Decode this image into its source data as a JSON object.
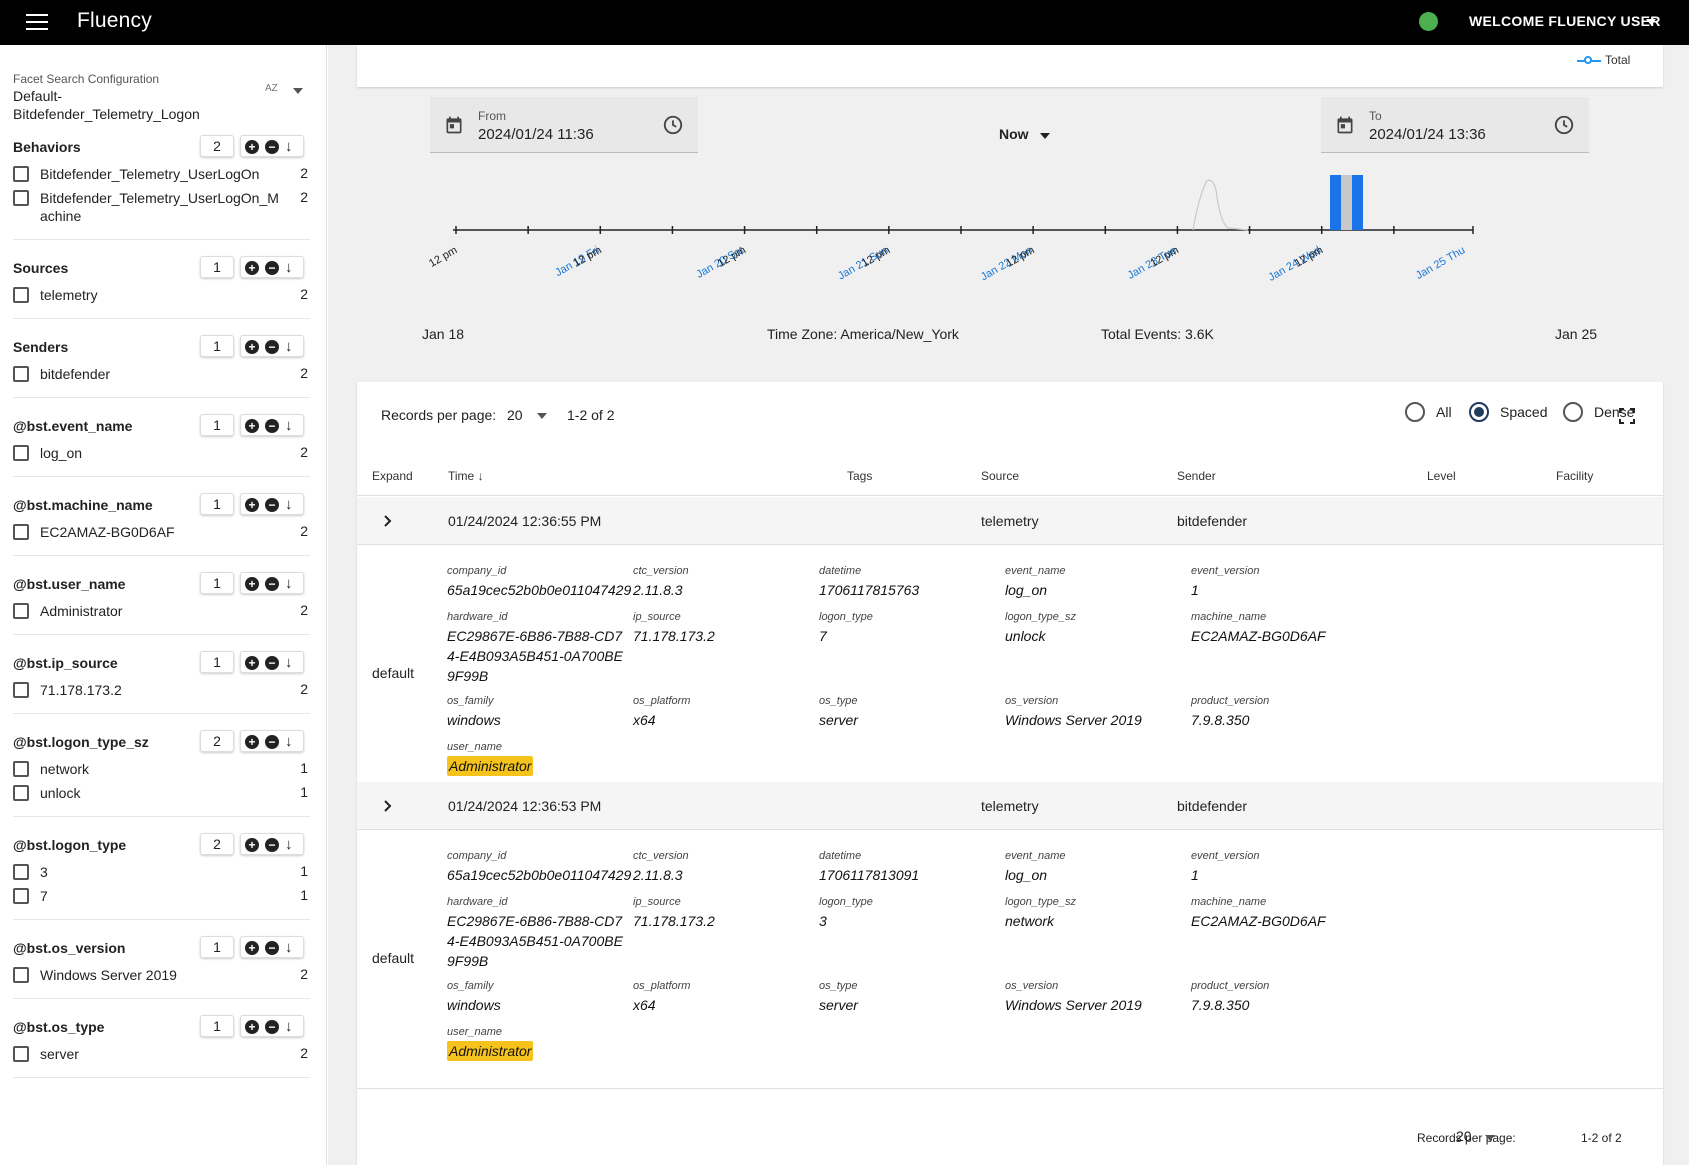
{
  "header": {
    "app_title": "Fluency",
    "welcome": "WELCOME FLUENCY USER"
  },
  "sidebar": {
    "config_label": "Facet Search Configuration",
    "config_value": "Default-Bitdefender_Telemetry_Logon",
    "sort_label": "AZ",
    "facets": [
      {
        "title": "Behaviors",
        "count": "2",
        "items": [
          {
            "label": "Bitdefender_Telemetry_UserLogOn",
            "n": "2"
          },
          {
            "label": "Bitdefender_Telemetry_UserLogOn_Machine",
            "n": "2"
          }
        ]
      },
      {
        "title": "Sources",
        "count": "1",
        "items": [
          {
            "label": "telemetry",
            "n": "2"
          }
        ]
      },
      {
        "title": "Senders",
        "count": "1",
        "items": [
          {
            "label": "bitdefender",
            "n": "2"
          }
        ]
      },
      {
        "title": "@bst.event_name",
        "count": "1",
        "items": [
          {
            "label": "log_on",
            "n": "2"
          }
        ]
      },
      {
        "title": "@bst.machine_name",
        "count": "1",
        "items": [
          {
            "label": "EC2AMAZ-BG0D6AF",
            "n": "2"
          }
        ]
      },
      {
        "title": "@bst.user_name",
        "count": "1",
        "items": [
          {
            "label": "Administrator",
            "n": "2"
          }
        ]
      },
      {
        "title": "@bst.ip_source",
        "count": "1",
        "items": [
          {
            "label": "71.178.173.2",
            "n": "2"
          }
        ]
      },
      {
        "title": "@bst.logon_type_sz",
        "count": "2",
        "items": [
          {
            "label": "network",
            "n": "1"
          },
          {
            "label": "unlock",
            "n": "1"
          }
        ]
      },
      {
        "title": "@bst.logon_type",
        "count": "2",
        "items": [
          {
            "label": "3",
            "n": "1"
          },
          {
            "label": "7",
            "n": "1"
          }
        ]
      },
      {
        "title": "@bst.os_version",
        "count": "1",
        "items": [
          {
            "label": "Windows Server 2019",
            "n": "2"
          }
        ]
      },
      {
        "title": "@bst.os_type",
        "count": "1",
        "items": [
          {
            "label": "server",
            "n": "2"
          }
        ]
      }
    ],
    "tools": [
      "refresh-icon",
      "edit-icon",
      "save-icon",
      "cloud-download-icon",
      "search-icon"
    ]
  },
  "timeline": {
    "legend": "Total",
    "from_label": "From",
    "from_value": "2024/01/24 11:36",
    "to_label": "To",
    "to_value": "2024/01/24 13:36",
    "preset": "Now",
    "start_label": "Jan 18",
    "end_label": "Jan 25",
    "timezone": "Time Zone: America/New_York",
    "total": "Total Events: 3.6K",
    "ticks": [
      "12 pm",
      "Jan 19 Fri",
      "12 pm",
      "Jan 20 Sat",
      "12 pm",
      "Jan 21 Sun",
      "12 pm",
      "Jan 22 Mon",
      "12 pm",
      "Jan 23 Tue",
      "12 pm",
      "Jan 24 Wed",
      "12 pm",
      "Jan 25 Thu"
    ],
    "colors": {
      "bar": "#1a73e8",
      "bar_mid": "#c8c8c8",
      "day_tick": "#1976d2"
    }
  },
  "table": {
    "rpp_label": "Records per page:",
    "rpp_value": "20",
    "range": "1-2 of 2",
    "view_options": [
      "All",
      "Spaced",
      "Dense"
    ],
    "view_selected": "Spaced",
    "columns": [
      "Expand",
      "Time",
      "Tags",
      "Source",
      "Sender",
      "Level",
      "Facility"
    ],
    "rows": [
      {
        "time": "01/24/2024 12:36:55 PM",
        "source": "telemetry",
        "sender": "bitdefender",
        "group": "default",
        "fields": {
          "company_id": "65a19cec52b0b0e011047429",
          "ctc_version": "2.11.8.3",
          "datetime": "1706117815763",
          "event_name": "log_on",
          "event_version": "1",
          "hardware_id": "EC29867E-6B86-7B88-CD74-E4B093A5B451-0A700BE9F99B",
          "ip_source": "71.178.173.2",
          "logon_type": "7",
          "logon_type_sz": "unlock",
          "machine_name": "EC2AMAZ-BG0D6AF",
          "os_family": "windows",
          "os_platform": "x64",
          "os_type": "server",
          "os_version": "Windows Server 2019",
          "product_version": "7.9.8.350",
          "user_name": "Administrator"
        }
      },
      {
        "time": "01/24/2024 12:36:53 PM",
        "source": "telemetry",
        "sender": "bitdefender",
        "group": "default",
        "fields": {
          "company_id": "65a19cec52b0b0e011047429",
          "ctc_version": "2.11.8.3",
          "datetime": "1706117813091",
          "event_name": "log_on",
          "event_version": "1",
          "hardware_id": "EC29867E-6B86-7B88-CD74-E4B093A5B451-0A700BE9F99B",
          "ip_source": "71.178.173.2",
          "logon_type": "3",
          "logon_type_sz": "network",
          "machine_name": "EC2AMAZ-BG0D6AF",
          "os_family": "windows",
          "os_platform": "x64",
          "os_type": "server",
          "os_version": "Windows Server 2019",
          "product_version": "7.9.8.350",
          "user_name": "Administrator"
        }
      }
    ],
    "field_keys": [
      "company_id",
      "ctc_version",
      "datetime",
      "event_name",
      "event_version",
      "hardware_id",
      "ip_source",
      "logon_type",
      "logon_type_sz",
      "machine_name",
      "os_family",
      "os_platform",
      "os_type",
      "os_version",
      "product_version",
      "user_name"
    ]
  }
}
